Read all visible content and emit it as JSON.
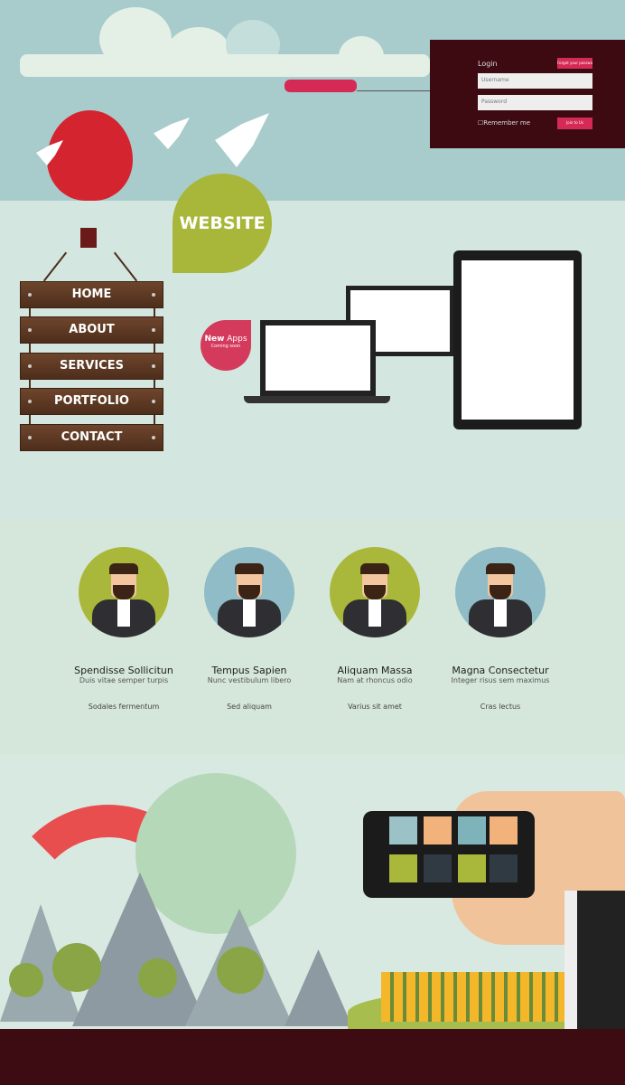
{
  "login": {
    "title": "Login",
    "forgot_label": "Forgot your password?",
    "username_placeholder": "Username",
    "password_placeholder": "Password",
    "remember_label": "Remember me",
    "join_label": "Join to Us"
  },
  "badge": {
    "website": "WEBSITE",
    "new": "New",
    "apps": "Apps",
    "coming": "Coming soon"
  },
  "nav": {
    "items": [
      {
        "label": "HOME"
      },
      {
        "label": "ABOUT"
      },
      {
        "label": "SERVICES"
      },
      {
        "label": "PORTFOLIO"
      },
      {
        "label": "CONTACT"
      }
    ]
  },
  "team": [
    {
      "name": "Spendisse Sollicitun",
      "role": "Duis vitae semper turpis",
      "extra": "Sodales fermentum",
      "bg": "#a9b83a"
    },
    {
      "name": "Tempus Sapien",
      "role": "Nunc vestibulum libero",
      "extra": "Sed aliquam",
      "bg": "#8fbcc6"
    },
    {
      "name": "Aliquam Massa",
      "role": "Nam at rhoncus odio",
      "extra": "Varius sit amet",
      "bg": "#a9b83a"
    },
    {
      "name": "Magna Consectetur",
      "role": "Integer risus sem maximus",
      "extra": "Cras lectus",
      "bg": "#8fbcc6"
    }
  ],
  "colors": {
    "accent": "#d52a55",
    "dark": "#3d0a12",
    "green": "#a9b83a"
  }
}
